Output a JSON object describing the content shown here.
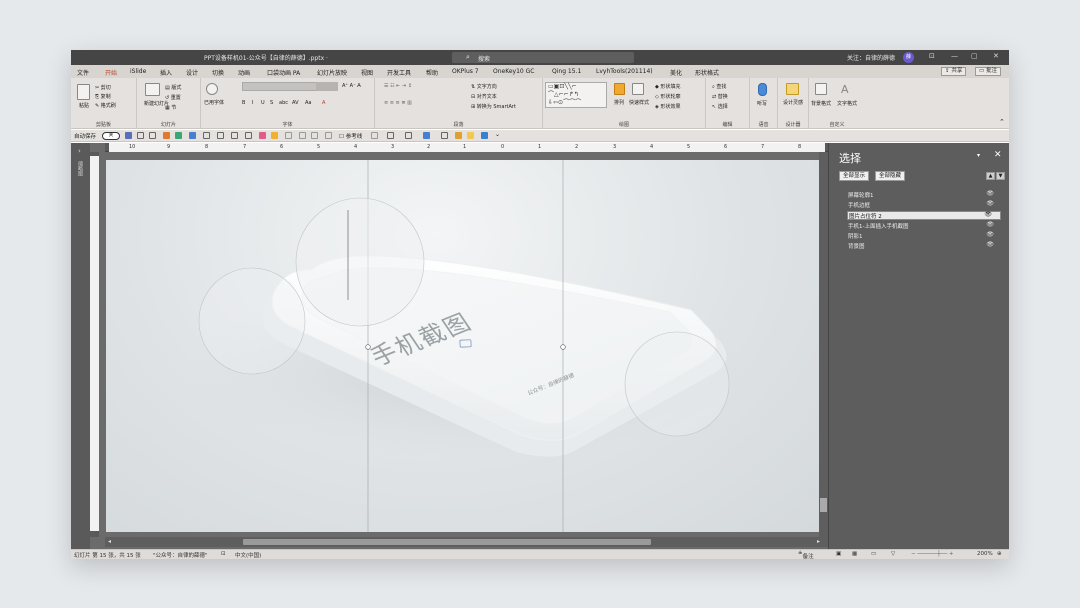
{
  "titlebar": {
    "title": "PPT设备样机01-公众号【自律的薛德】.pptx  ·",
    "search_placeholder": "搜索",
    "user": "关注：自律的薛德",
    "avatar": "薛",
    "buttons": [
      "⊡",
      "—",
      "▢",
      "✕"
    ]
  },
  "menu": {
    "tabs": [
      "文件",
      "开始",
      "iSlide",
      "插入",
      "设计",
      "切换",
      "动画",
      "口袋动画 PA",
      "幻灯片放映",
      "视图",
      "开发工具",
      "帮助",
      "OKPlus 7",
      "OneKey10 GC",
      "Qing 15.1",
      "LvyhTools(201114)",
      "美化",
      "形状格式"
    ],
    "active": "开始",
    "share": "共享",
    "comment": "批注"
  },
  "ribbon": {
    "groups": [
      {
        "label": "剪贴板",
        "buttons": [
          "粘贴",
          "剪切",
          "复制",
          "格式刷"
        ]
      },
      {
        "label": "幻灯片",
        "buttons": [
          "新建幻灯片",
          "版式",
          "重置",
          "节"
        ]
      },
      {
        "label": "字体",
        "buttons": [
          "已用字体",
          "B",
          "I",
          "U",
          "S",
          "abc",
          "AV",
          "Aa",
          "A"
        ]
      },
      {
        "label": "段落",
        "buttons": [
          "文字方向",
          "对齐文本",
          "转换为 SmartArt"
        ]
      },
      {
        "label": "绘图",
        "buttons": [
          "排列",
          "快速样式",
          "形状填充",
          "形状轮廓",
          "形状效果"
        ]
      },
      {
        "label": "编辑",
        "buttons": [
          "查找",
          "替换",
          "选择"
        ]
      },
      {
        "label": "语音",
        "buttons": [
          "听写"
        ]
      },
      {
        "label": "设计器",
        "buttons": [
          "设计灵感"
        ]
      },
      {
        "label": "自定义",
        "buttons": [
          "背景格式",
          "文字格式"
        ]
      }
    ]
  },
  "qat": {
    "autosave": "自动保存",
    "toggle": "关",
    "reference_line": "参考线"
  },
  "thumbstrip": {
    "label": "缩略图"
  },
  "ruler": {
    "h_ticks": [
      "10",
      "9",
      "8",
      "7",
      "6",
      "5",
      "4",
      "3",
      "2",
      "1",
      "0",
      "1",
      "2",
      "3",
      "4",
      "5",
      "6",
      "7",
      "8"
    ]
  },
  "slide": {
    "phone_title": "手机截图",
    "phone_footer": "公众号：自律的薛德"
  },
  "pane": {
    "title": "选择",
    "show_all": "全部显示",
    "hide_all": "全部隐藏",
    "items": [
      {
        "name": "屏幕轮廓1",
        "selected": false
      },
      {
        "name": "手机边框",
        "selected": false
      },
      {
        "name": "图片占位符 2",
        "selected": true
      },
      {
        "name": "手机1-上面插入手机截图",
        "selected": false
      },
      {
        "name": "阴影1",
        "selected": false
      },
      {
        "name": "背景图",
        "selected": false
      }
    ]
  },
  "status": {
    "slide_count": "幻灯片 第 15 张，共 15 张",
    "theme": "\"公众号：自律的薛德\"",
    "language": "中文(中国)",
    "notes": "备注",
    "zoom": "200%"
  },
  "colors": {
    "accent": "#b7472a",
    "titlebar": "#454545",
    "pane": "#5d5d5d"
  }
}
